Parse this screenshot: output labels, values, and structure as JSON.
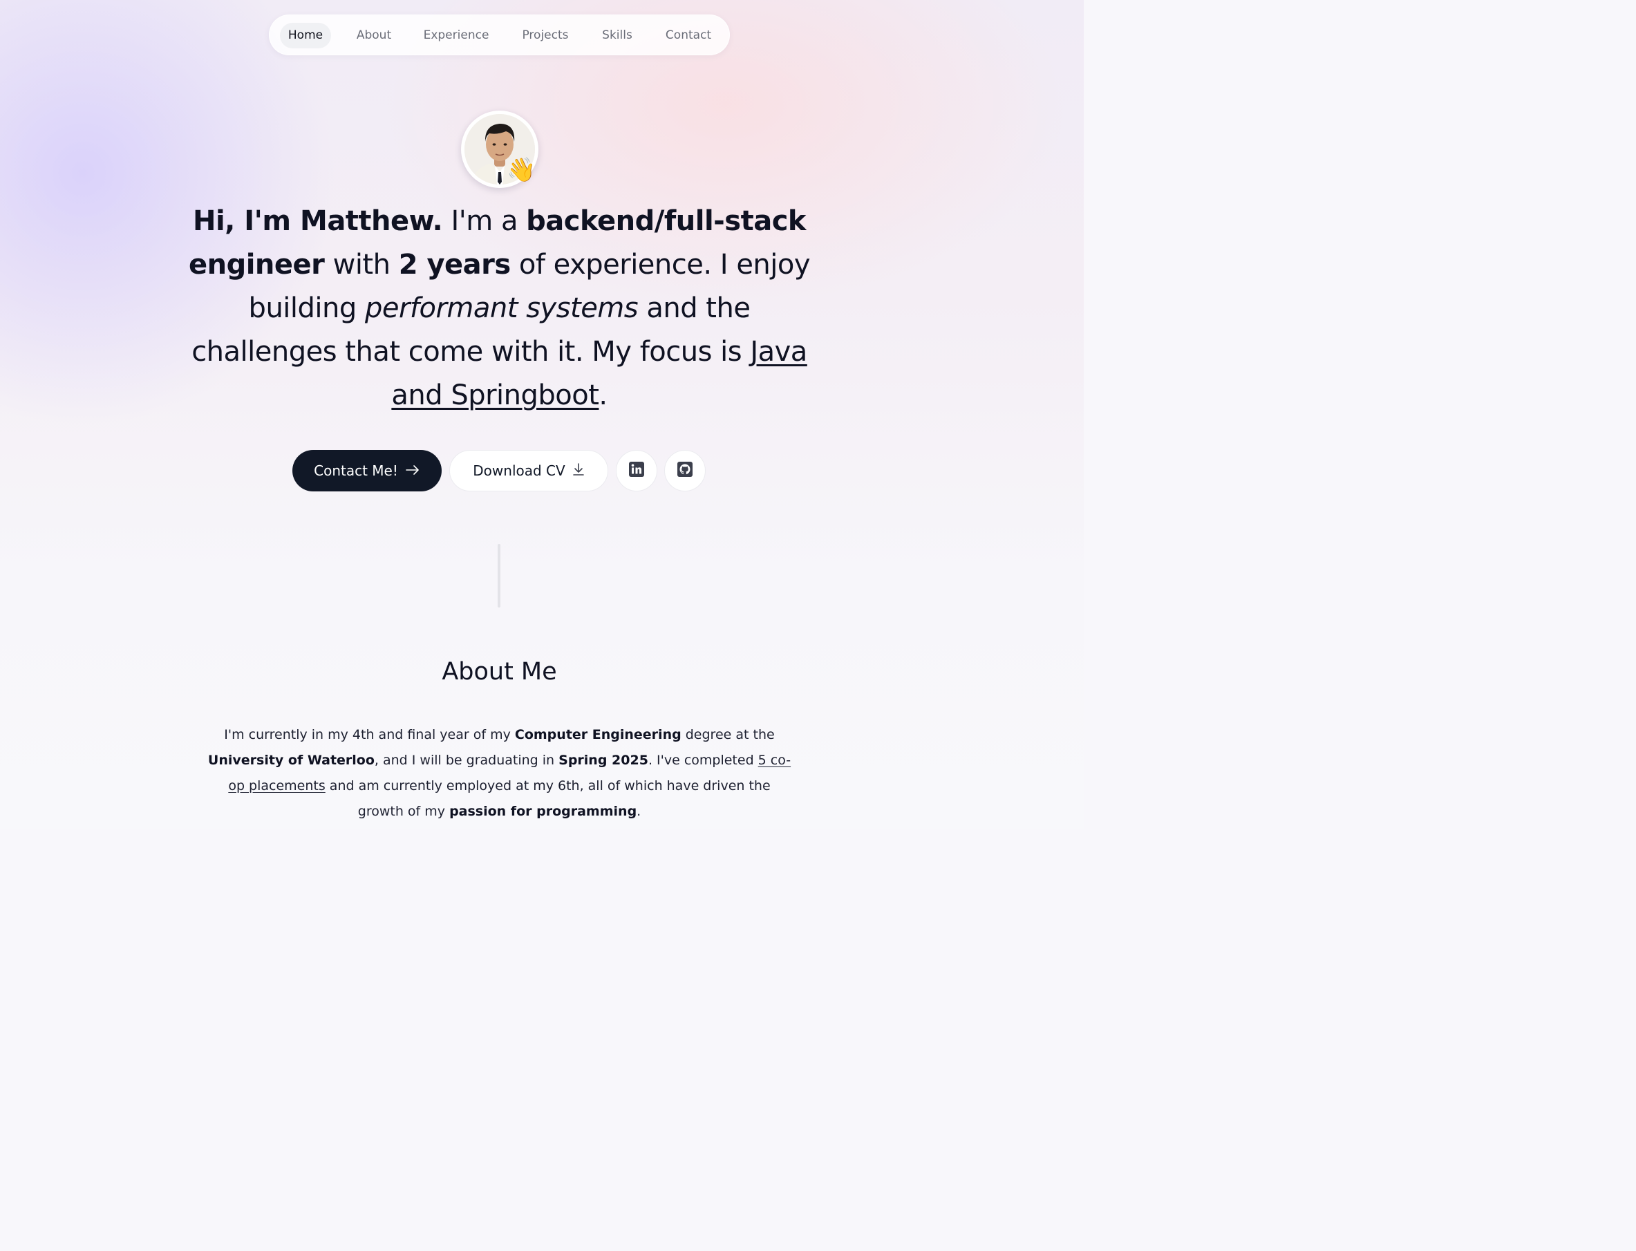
{
  "nav": {
    "items": [
      {
        "label": "Home",
        "active": true
      },
      {
        "label": "About",
        "active": false
      },
      {
        "label": "Experience",
        "active": false
      },
      {
        "label": "Projects",
        "active": false
      },
      {
        "label": "Skills",
        "active": false
      },
      {
        "label": "Contact",
        "active": false
      }
    ]
  },
  "profile": {
    "wave_emoji": "👋"
  },
  "hero": {
    "greeting": "Hi, I'm Matthew.",
    "t1": " I'm a ",
    "role": "backend/full-stack engineer",
    "t2": " with ",
    "years": "2 years",
    "t3": " of experience. I enjoy building ",
    "emphasis": "performant systems",
    "t4": " and the challenges that come with it. My focus is ",
    "focus_link": "Java and Springboot",
    "t5": "."
  },
  "actions": {
    "contact_label": "Contact Me!",
    "contact_icon": "arrow-right-icon",
    "cv_label": "Download CV",
    "cv_icon": "download-icon",
    "linkedin_icon": "linkedin-icon",
    "github_icon": "github-icon"
  },
  "about": {
    "title": "About Me",
    "p1": "I'm currently in my 4th and final year of my ",
    "degree": "Computer Engineering",
    "p2": " degree at the ",
    "university": "University of Waterloo",
    "p3": ", and I will be graduating in ",
    "grad": "Spring 2025",
    "p4": ". I've completed ",
    "coop_link": "5 co-op placements",
    "p5": " and am currently employed at my 6th, all of which have driven the growth of my ",
    "passion": "passion for programming",
    "p6": "."
  },
  "colors": {
    "primary_dark": "#111827",
    "accent_lavender": "#c6bcff",
    "accent_pink": "#ffd6d6"
  }
}
